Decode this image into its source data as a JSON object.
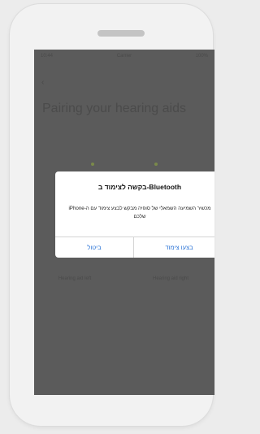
{
  "statusbar": {
    "left": "10:44",
    "center": "Carrier",
    "right": "100%"
  },
  "back_icon": "‹",
  "page_title": "Pairing your hearing aids",
  "left_aid_label": "Hearing aid left",
  "right_aid_label": "Hearing aid right",
  "dialog": {
    "title": "בקשה לצימוד ב-Bluetooth",
    "message": "מכשיר השמיעה השמאלי של סופיה מבקש לבצע צימוד עם ה-iPhone שלכם",
    "cancel_label": "ביטול",
    "pair_label": "בצעו צימוד"
  },
  "colors": {
    "accent": "#2a73d6",
    "overlay": "#5b5b5b"
  }
}
